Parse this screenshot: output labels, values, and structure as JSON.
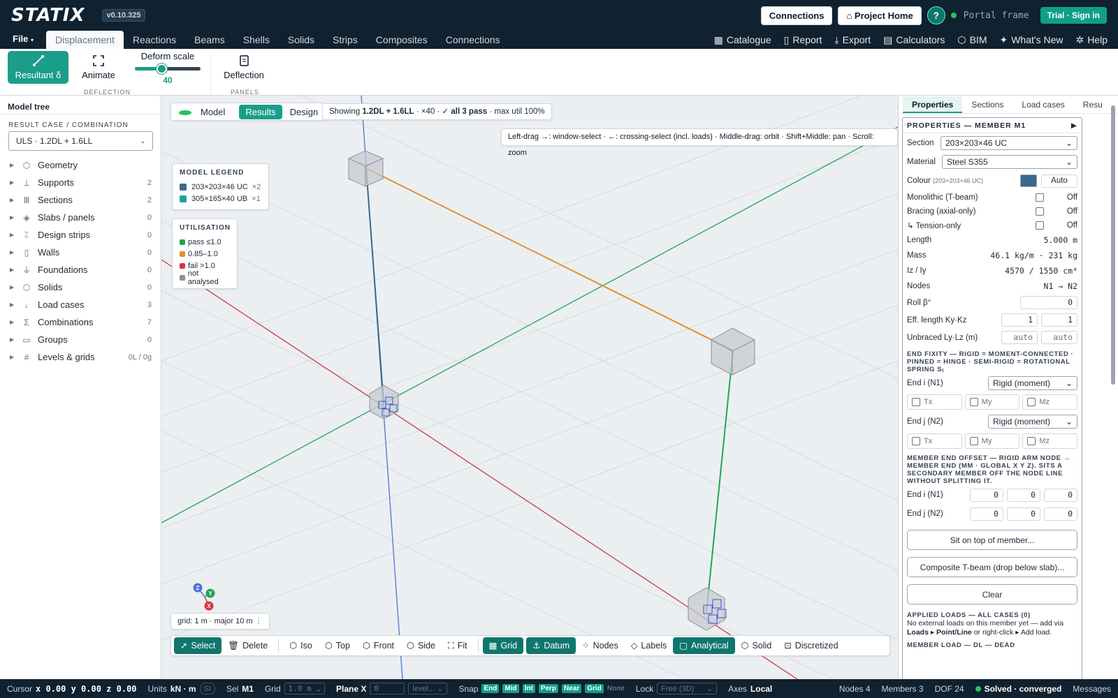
{
  "app": {
    "logo": "STATIX",
    "version": "v0.10.325"
  },
  "top": {
    "connections": "Connections",
    "project_home": "Project Home",
    "help": "?",
    "project_name": "Portal frame",
    "trial": "Trial · Sign in"
  },
  "menu": {
    "file": "File",
    "tabs": [
      "Displacement",
      "Reactions",
      "Beams",
      "Shells",
      "Solids",
      "Strips",
      "Composites",
      "Connections"
    ],
    "right": [
      "Catalogue",
      "Report",
      "Export",
      "Calculators",
      "BIM",
      "What's New",
      "Help"
    ]
  },
  "ribbon": {
    "resultant": "Resultant δ",
    "animate": "Animate",
    "deform_title": "Deform scale",
    "deform_value": "40",
    "deform_fraction": 0.4,
    "deflection": "Deflection",
    "group_deflection": "DEFLECTION",
    "group_panels": "PANELS"
  },
  "left": {
    "title": "Model tree",
    "rc_label": "RESULT CASE / COMBINATION",
    "rc_value": "ULS · 1.2DL + 1.6LL",
    "items": [
      {
        "label": "Geometry",
        "count": ""
      },
      {
        "label": "Supports",
        "count": "2"
      },
      {
        "label": "Sections",
        "count": "2"
      },
      {
        "label": "Slabs / panels",
        "count": "0"
      },
      {
        "label": "Design strips",
        "count": "0"
      },
      {
        "label": "Walls",
        "count": "0"
      },
      {
        "label": "Foundations",
        "count": "0"
      },
      {
        "label": "Solids",
        "count": "0"
      },
      {
        "label": "Load cases",
        "count": "3"
      },
      {
        "label": "Combinations",
        "count": "7"
      },
      {
        "label": "Groups",
        "count": "0"
      },
      {
        "label": "Levels & grids",
        "count": "0L / 0g"
      }
    ]
  },
  "viewport": {
    "modes": [
      "Model",
      "Results",
      "Design"
    ],
    "showing_prefix": "Showing ",
    "showing_case": "1.2DL + 1.6LL",
    "showing_scale": " · ×40 · ",
    "showing_pass": "✓ all 3 pass",
    "showing_suffix": " · max util 100%",
    "hint": "Left-drag →: window-select · ←: crossing-select (incl. loads) · Middle-drag: orbit · Shift+Middle: pan · Scroll: zoom",
    "legend_title": "MODEL LEGEND",
    "legend": [
      {
        "name": "203×203×46 UC",
        "count": "×2",
        "color": "#3a6a8c"
      },
      {
        "name": "305×165×40 UB",
        "count": "×1",
        "color": "#1f9ea3"
      }
    ],
    "util_title": "UTILISATION",
    "util": [
      {
        "name": "pass ≤1.0",
        "color": "#22a559"
      },
      {
        "name": "0.85–1.0",
        "color": "#e0902a"
      },
      {
        "name": "fail >1.0",
        "color": "#d9363e"
      },
      {
        "name": "not analysed",
        "color": "#8b9298"
      }
    ],
    "grid_info": "grid: 1 m · major 10 m",
    "axes": {
      "z": "Z",
      "y": "Y",
      "x": "X"
    },
    "toolbar": {
      "select": "Select",
      "delete": "Delete",
      "iso": "Iso",
      "top": "Top",
      "front": "Front",
      "side": "Side",
      "fit": "Fit",
      "grid": "Grid",
      "datum": "Datum",
      "nodes": "Nodes",
      "labels": "Labels",
      "analytical": "Analytical",
      "solid": "Solid",
      "discretized": "Discretized"
    }
  },
  "right": {
    "tabs": [
      "Properties",
      "Sections",
      "Load cases",
      "Resu"
    ],
    "header": "PROPERTIES — MEMBER M1",
    "section_label": "Section",
    "section_value": "203×203×46 UC",
    "material_label": "Material",
    "material_value": "Steel S355",
    "colour_label": "Colour",
    "colour_sub": "(203×203×46 UC)",
    "colour_auto": "Auto",
    "colour_swatch": "#3a6a8c",
    "monolithic": "Monolithic (T-beam)",
    "bracing": "Bracing (axial-only)",
    "tension": "↳ Tension-only",
    "off": "Off",
    "length_label": "Length",
    "length_value": "5.000 m",
    "mass_label": "Mass",
    "mass_value": "46.1 kg/m · 231 kg",
    "iz_label": "Iz / Iy",
    "iz_value": "4570 / 1550 cm⁴",
    "nodes_label": "Nodes",
    "nodes_value": "N1 → N2",
    "roll_label": "Roll β°",
    "roll_value": "0",
    "eff_label": "Eff. length Ky·Kz",
    "eff_y": "1",
    "eff_z": "1",
    "unbraced_label": "Unbraced Ly·Lz (m)",
    "unbraced_y": "auto",
    "unbraced_z": "auto",
    "fixity_title": "END FIXITY — RIGID = MOMENT-CONNECTED · PINNED = HINGE · SEMI-RIGID = ROTATIONAL SPRING Sⱼ",
    "end_i_label": "End i (N1)",
    "end_i_value": "Rigid (moment)",
    "end_j_label": "End j (N2)",
    "end_j_value": "Rigid (moment)",
    "tx": "Tx",
    "my": "My",
    "mz": "Mz",
    "offset_title": "MEMBER END OFFSET — RIGID ARM NODE → MEMBER END (MM · GLOBAL X Y Z). SITS A SECONDARY MEMBER OFF THE NODE LINE WITHOUT SPLITTING IT.",
    "off_i_label": "End i (N1)",
    "off_j_label": "End j (N2)",
    "off_zero": "0",
    "sit_btn": "Sit on top of member...",
    "composite_btn": "Composite T-beam (drop below slab)...",
    "clear_btn": "Clear",
    "applied_title": "APPLIED LOADS — ALL CASES (0)",
    "applied_text": "No external loads on this member yet — add via ",
    "applied_b1": "Loads ▸ Point/Line",
    "applied_mid": " or right-click ▸ Add load.",
    "member_load_title": "MEMBER LOAD — DL — DEAD"
  },
  "status": {
    "cursor_label": "Cursor",
    "cursor": "x 0.00 y 0.00 z 0.00",
    "units_label": "Units",
    "units": "kN · m",
    "si": "SI",
    "sel_label": "Sel",
    "sel": "M1",
    "grid_label": "Grid",
    "grid": "1.0 m",
    "plane_label": "Plane X",
    "plane_value": "0",
    "level": "level...",
    "snap_label": "Snap",
    "snaps": [
      "End",
      "Mid",
      "Int",
      "Perp",
      "Near",
      "Grid"
    ],
    "snap_none": "None",
    "lock_label": "Lock",
    "lock": "Free (3D)",
    "axes_label": "Axes",
    "axes": "Local",
    "nodes": "Nodes 4",
    "members": "Members 3",
    "dof": "DOF 24",
    "solved": "Solved · converged",
    "messages": "Messages"
  }
}
